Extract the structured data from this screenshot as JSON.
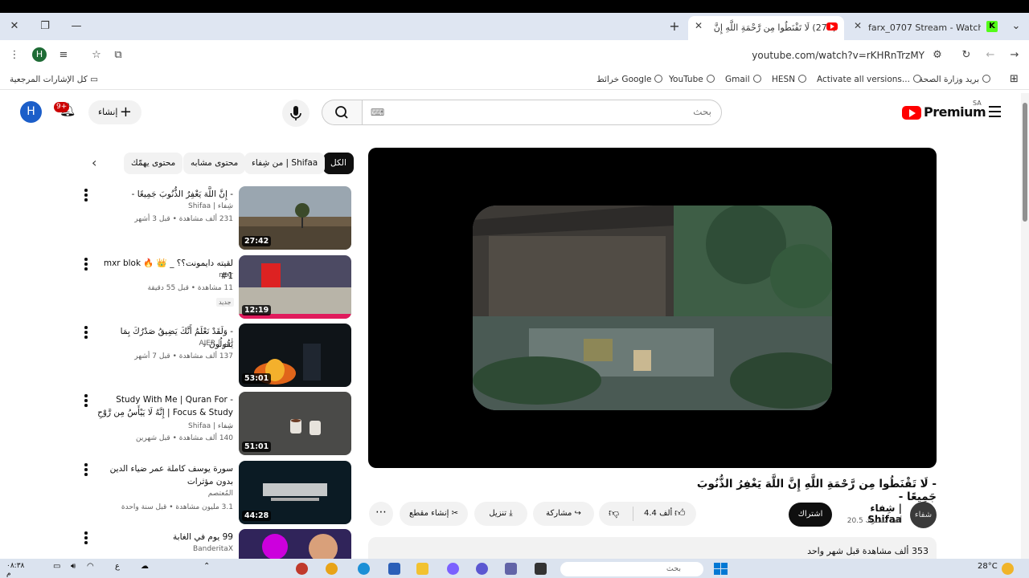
{
  "browser": {
    "tabs": [
      {
        "title": "(273) لَا تَقْنَطُوا مِن رَّحْمَةِ اللَّهِ إِنَّ",
        "active": true
      },
      {
        "title": "farx_0707 Stream - Watch Live o",
        "active": false
      }
    ],
    "url": "youtube.com/watch?v=rKHRnTrzMY",
    "profile_initial": "H",
    "bookmarks": [
      "بريد وزارة الصحة",
      "Activate all versions...",
      "HESN",
      "Gmail",
      "YouTube",
      "خرائط Google"
    ],
    "bookmarks_folder": "كل الإشارات المرجعية"
  },
  "youtube": {
    "logo_text": "Premium",
    "region": "SA",
    "search_placeholder": "بحث",
    "create_label": "إنشاء",
    "notif_count": "9+",
    "avatar_initial": "H"
  },
  "chips": [
    "الكل",
    "من شِفاء | Shifaa",
    "محتوى مشابه",
    "محتوى يهمّك"
  ],
  "recommendations": [
    {
      "title": "- إِنَّ اللَّهَ يَغْفِرُ الذُّنُوبَ جَمِيعًا -",
      "channel": "شِفاء | Shifaa",
      "meta": "231 ألف مشاهدة • قبل 3 أشهر",
      "duration": "27:42"
    },
    {
      "title": "لقيته دايمونت؟؟ _ 👑 🔥 mxr blok #1",
      "channel": "mxr",
      "meta": "11 مشاهدة • قبل 55 دقيقة",
      "duration": "12:19",
      "badge": "جديد"
    },
    {
      "title": "- وَلَقَدْ نَعْلَمُ أَنَّكَ يَضِيقُ صَدْرُكَ بِمَا يَقُولُونَ -",
      "channel": "أجر | AJER",
      "meta": "137 ألف مشاهدة • قبل 7 أشهر",
      "duration": "53:01"
    },
    {
      "title": "- Study With Me | Quran For Focus & Study | إِنَّهُ لَا يَيْأَسُ مِن رَّوْحِ ...",
      "channel": "شِفاء | Shifaa",
      "meta": "140 ألف مشاهدة • قبل شهرين",
      "duration": "51:01"
    },
    {
      "title": "سورة يوسف كاملة عمر ضياء الدين بدون مؤثرات",
      "channel": "المُعتصم",
      "meta": "3.1 مليون مشاهدة • قبل سنة واحدة",
      "duration": "44:28"
    },
    {
      "title": "99 يوم في الغابة",
      "channel": "BanderitaX",
      "meta": "",
      "duration": ""
    }
  ],
  "video": {
    "title": "- لَا تَقْنَطُوا مِن رَّحْمَةِ اللَّهِ إِنَّ اللَّهَ يَغْفِرُ الذُّنُوبَ جَمِيعًا -",
    "channel_name": "شِفاء | Shifaa",
    "subscribers": "20.5 ألف مشترك",
    "subscribe_label": "اشتراك",
    "likes": "4.4 ألف",
    "share_label": "مشاركة",
    "download_label": "تنزيل",
    "clip_label": "إنشاء مقطع",
    "views_line": "353 ألف مشاهدة  قبل شهر واحد"
  },
  "taskbar": {
    "time": "٠٨:٣٨",
    "period": "م",
    "lang": "ع",
    "temperature": "28°C",
    "search_placeholder": "بحث"
  }
}
